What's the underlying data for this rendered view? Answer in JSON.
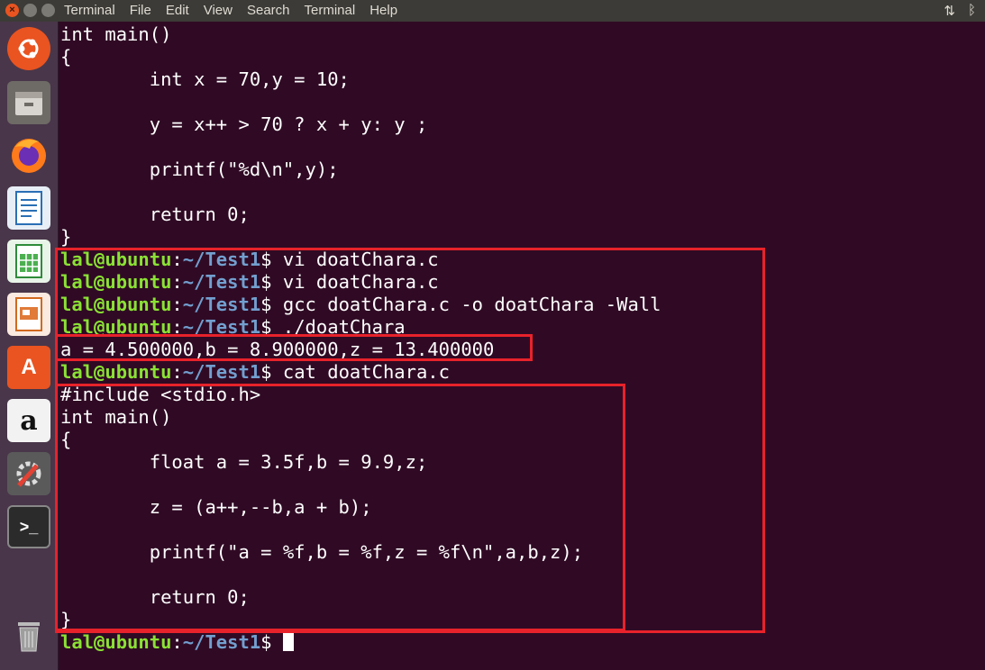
{
  "menubar": {
    "items": [
      "Terminal",
      "File",
      "Edit",
      "View",
      "Search",
      "Terminal",
      "Help"
    ],
    "tray_icons": [
      "network-updown-icon",
      "bluetooth-icon"
    ]
  },
  "launcher": {
    "icons": [
      "ubuntu-dash-icon",
      "files-icon",
      "firefox-icon",
      "libreoffice-writer-icon",
      "libreoffice-calc-icon",
      "libreoffice-impress-icon",
      "ubuntu-software-icon",
      "amazon-icon",
      "system-settings-icon",
      "terminal-icon",
      "trash-icon"
    ]
  },
  "terminal": {
    "prompt": {
      "user": "lal@ubuntu",
      "sep": ":",
      "path": "~/Test1",
      "symbol": "$ "
    },
    "lines": [
      {
        "type": "text",
        "text": "int main()"
      },
      {
        "type": "text",
        "text": "{"
      },
      {
        "type": "text",
        "text": "        int x = 70,y = 10;"
      },
      {
        "type": "text",
        "text": ""
      },
      {
        "type": "text",
        "text": "        y = x++ > 70 ? x + y: y ;"
      },
      {
        "type": "text",
        "text": ""
      },
      {
        "type": "text",
        "text": "        printf(\"%d\\n\",y);"
      },
      {
        "type": "text",
        "text": ""
      },
      {
        "type": "text",
        "text": "        return 0;"
      },
      {
        "type": "text",
        "text": "}"
      },
      {
        "type": "prompt",
        "text": "vi doatChara.c"
      },
      {
        "type": "prompt",
        "text": "vi doatChara.c"
      },
      {
        "type": "prompt",
        "text": "gcc doatChara.c -o doatChara -Wall"
      },
      {
        "type": "prompt",
        "text": "./doatChara"
      },
      {
        "type": "text",
        "text": "a = 4.500000,b = 8.900000,z = 13.400000"
      },
      {
        "type": "prompt",
        "text": "cat doatChara.c"
      },
      {
        "type": "text",
        "text": "#include <stdio.h>"
      },
      {
        "type": "text",
        "text": "int main()"
      },
      {
        "type": "text",
        "text": "{"
      },
      {
        "type": "text",
        "text": "        float a = 3.5f,b = 9.9,z;"
      },
      {
        "type": "text",
        "text": ""
      },
      {
        "type": "text",
        "text": "        z = (a++,--b,a + b);"
      },
      {
        "type": "text",
        "text": ""
      },
      {
        "type": "text",
        "text": "        printf(\"a = %f,b = %f,z = %f\\n\",a,b,z);"
      },
      {
        "type": "text",
        "text": ""
      },
      {
        "type": "text",
        "text": "        return 0;"
      },
      {
        "type": "text",
        "text": "}"
      },
      {
        "type": "prompt",
        "text": "",
        "cursor": true
      }
    ]
  },
  "colors": {
    "background": "#300a24",
    "user": "#8ae234",
    "path": "#729fcf",
    "highlight": "#e8222b"
  }
}
